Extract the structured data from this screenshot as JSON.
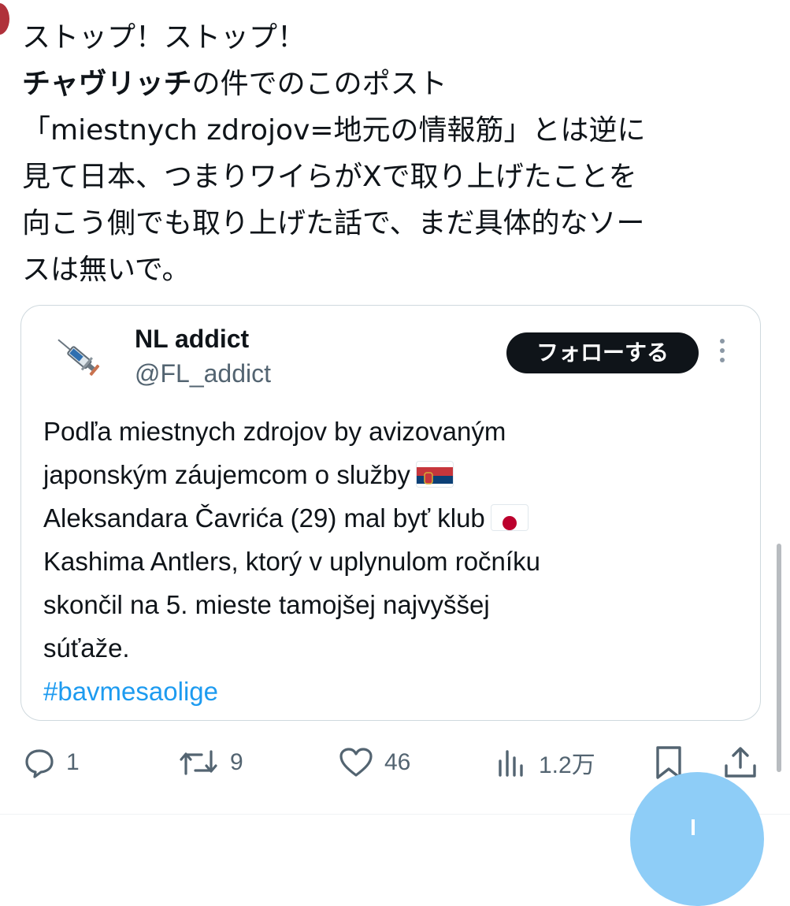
{
  "tweet": {
    "lines": [
      {
        "text": "ストップ！ストップ！"
      },
      {
        "bold": "チャヴリッチ",
        "text": "の件でのこのポスト"
      },
      {
        "text": "「miestnych zdrojov=地元の情報筋」とは逆に"
      },
      {
        "text": "見て日本、つまりワイらがXで取り上げたことを"
      },
      {
        "text": "向こう側でも取り上げた話で、まだ具体的なソー"
      },
      {
        "text": "スは無いで。"
      }
    ]
  },
  "quote": {
    "name": "NL addict",
    "handle": "@FL_addict",
    "avatar_icon": "syringe-icon",
    "follow_label": "フォローする",
    "lines": [
      {
        "text": "Podľa miestnych zdrojov by avizovaným"
      },
      {
        "text": "japonským záujemcom o služby",
        "flag": "serbia-flag-icon"
      },
      {
        "text": "Aleksandara Čavrića (29) mal byť klub",
        "flag": "japan-flag-icon"
      },
      {
        "text": "Kashima Antlers, ktorý v uplynulom ročníku"
      },
      {
        "text": "skončil na 5. mieste tamojšej najvyššej"
      },
      {
        "text": "súťaže."
      }
    ],
    "hashtag": "#bavmesaolige"
  },
  "actions": {
    "reply": {
      "icon": "reply-icon",
      "count": "1"
    },
    "repost": {
      "icon": "repost-icon",
      "count": "9"
    },
    "like": {
      "icon": "heart-icon",
      "count": "46"
    },
    "views": {
      "icon": "views-icon",
      "count": "1.2万"
    },
    "bookmark": {
      "icon": "bookmark-icon"
    },
    "share": {
      "icon": "share-icon"
    }
  },
  "colors": {
    "text": "#0f1419",
    "secondary": "#536471",
    "link": "#1d9bf0",
    "fab": "#8ecdf7",
    "avatar": "#b0313b"
  }
}
